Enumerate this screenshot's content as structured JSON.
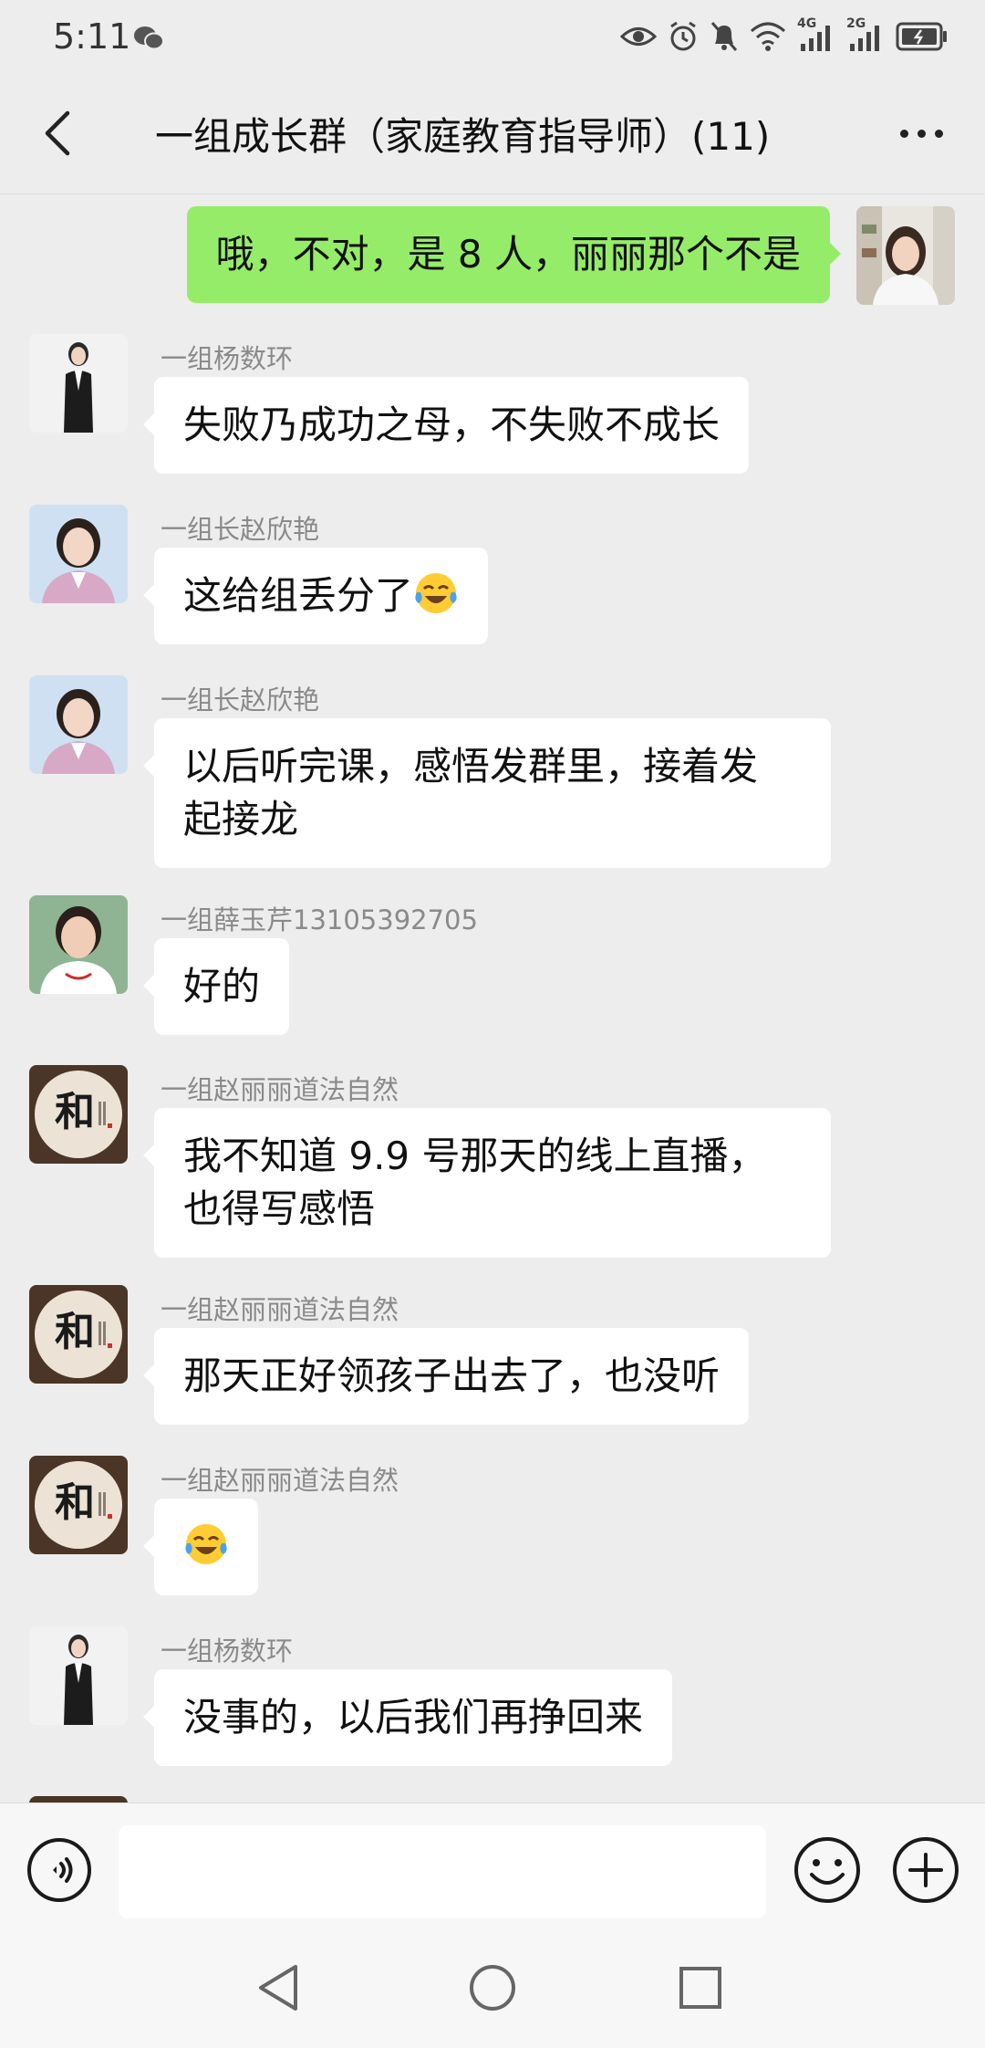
{
  "status_bar": {
    "time": "5:11",
    "net1": "4G",
    "net2": "2G"
  },
  "header": {
    "title": "一组成长群（家庭教育指导师）(11)"
  },
  "messages": [
    {
      "sender": "",
      "text": "哦，不对，是 8 人，丽丽那个不是",
      "mine": true
    },
    {
      "sender": "一组杨数环",
      "text": "失败乃成功之母，不失败不成长"
    },
    {
      "sender": "一组长赵欣艳",
      "text": "这给组丢分了"
    },
    {
      "sender": "一组长赵欣艳",
      "line1": "以后听完课，感悟发群里，接着发",
      "line2": "起接龙"
    },
    {
      "sender": "一组薛玉芹13105392705",
      "text": "好的"
    },
    {
      "sender": "一组赵丽丽道法自然",
      "line1": "我不知道 9.9 号那天的线上直播，",
      "line2": "也得写感悟"
    },
    {
      "sender": "一组赵丽丽道法自然",
      "text": "那天正好领孩子出去了，也没听"
    },
    {
      "sender": "一组赵丽丽道法自然",
      "text": ""
    },
    {
      "sender": "一组杨数环",
      "text": "没事的，以后我们再挣回来"
    }
  ],
  "avatars": {
    "calligraphy_char": "和"
  },
  "input": {
    "placeholder": ""
  },
  "colors": {
    "background": "#ededed",
    "my_bubble": "#95ec69",
    "other_bubble": "#ffffff",
    "sender_name": "#8a8a8a"
  },
  "icons": [
    "back-arrow-icon",
    "more-icon",
    "voice-icon",
    "emoji-icon",
    "plus-icon",
    "nav-back-icon",
    "nav-home-icon",
    "nav-recent-icon",
    "crying-laughing-emoji"
  ]
}
